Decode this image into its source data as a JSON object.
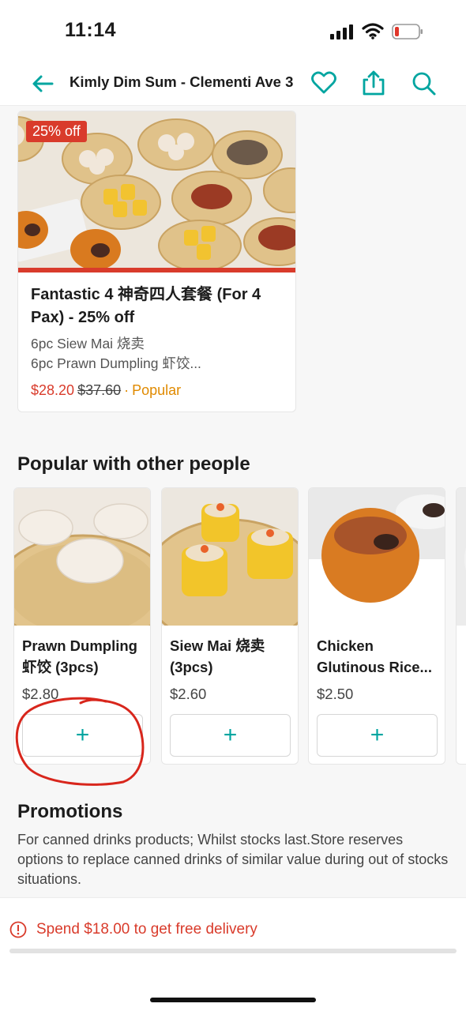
{
  "status_bar": {
    "time": "11:14"
  },
  "header": {
    "title": "Kimly Dim Sum - Clementi Ave 3"
  },
  "deal": {
    "badge": "25% off",
    "title": "Fantastic 4 神奇四人套餐 (For 4 Pax) - 25% off",
    "desc_line1": "6pc Siew Mai 烧卖",
    "desc_line2": "6pc Prawn Dumpling 虾饺...",
    "price_now": "$28.20",
    "price_was": "$37.60",
    "separator": "·",
    "tag": "Popular"
  },
  "popular": {
    "title": "Popular with other people",
    "items": [
      {
        "name": "Prawn Dumpling 虾饺 (3pcs)",
        "price": "$2.80",
        "add_label": "+"
      },
      {
        "name": "Siew Mai 烧卖 (3pcs)",
        "price": "$2.60",
        "add_label": "+"
      },
      {
        "name": "Chicken Glutinous Rice...",
        "price": "$2.50",
        "add_label": "+"
      }
    ]
  },
  "promotions": {
    "title": "Promotions",
    "text": "For canned drinks products; Whilst stocks last.Store reserves options to replace canned drinks of similar value during out of stocks situations."
  },
  "footer": {
    "delivery_text": "Spend $18.00 to get free delivery",
    "progress_fraction": 0.0
  },
  "colors": {
    "accent": "#00a5a0",
    "alert": "#d93b2b",
    "popular": "#e08a00",
    "annotation": "#d8261c"
  },
  "icons": [
    "back-arrow-icon",
    "heart-icon",
    "share-icon",
    "search-icon",
    "info-icon",
    "plus-icon"
  ]
}
